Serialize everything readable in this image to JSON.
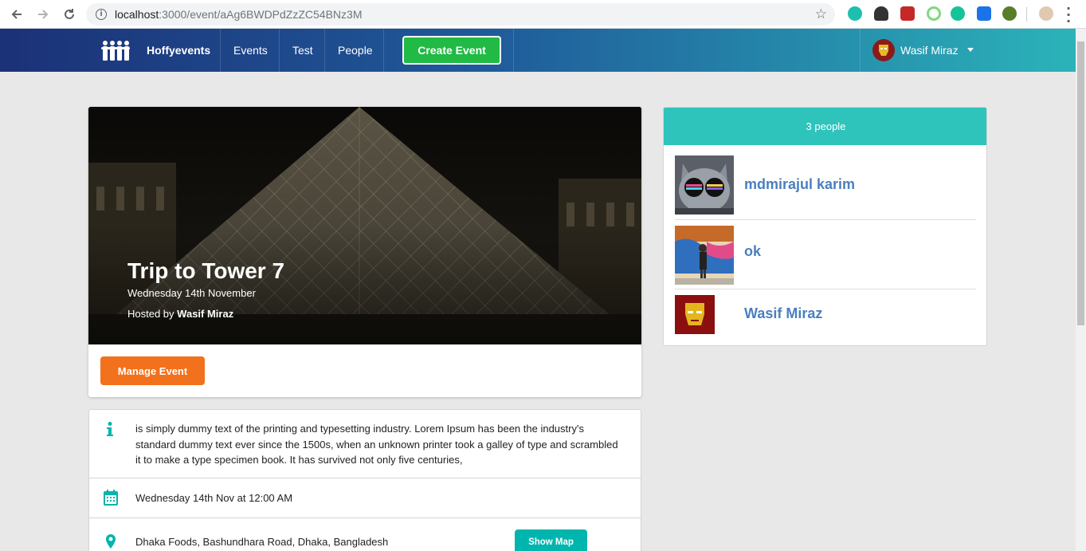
{
  "browser": {
    "url_host": "localhost",
    "url_path": ":3000/event/aAg6BWDPdZzZC54BNz3M"
  },
  "navbar": {
    "brand": "Hoffyevents",
    "items": [
      {
        "label": "Events"
      },
      {
        "label": "Test"
      },
      {
        "label": "People"
      }
    ],
    "create_button": "Create Event",
    "user_name": "Wasif Miraz",
    "gradient_start": "#1c3177",
    "gradient_end": "#2bb3b9"
  },
  "event": {
    "title": "Trip to Tower 7",
    "date": "Wednesday 14th November",
    "hosted_prefix": "Hosted by",
    "host": "Wasif Miraz",
    "manage_button": "Manage Event",
    "description": "is simply dummy text of the printing and typesetting industry. Lorem Ipsum has been the industry's standard dummy text ever since the 1500s, when an unknown printer took a galley of type and scrambled it to make a type specimen book. It has survived not only five centuries,",
    "datetime": "Wednesday 14th Nov at 12:00 AM",
    "venue": "Dhaka Foods, Bashundhara Road, Dhaka, Bangladesh",
    "show_map_button": "Show Map"
  },
  "attendees": {
    "header": "3 people",
    "people": [
      {
        "name": "mdmirajul karim"
      },
      {
        "name": "ok"
      },
      {
        "name": "Wasif Miraz"
      }
    ]
  },
  "colors": {
    "accent_teal": "#00b5ad",
    "create_green": "#21ba45",
    "manage_orange": "#f2711c",
    "link_blue": "#4a7fbf"
  }
}
